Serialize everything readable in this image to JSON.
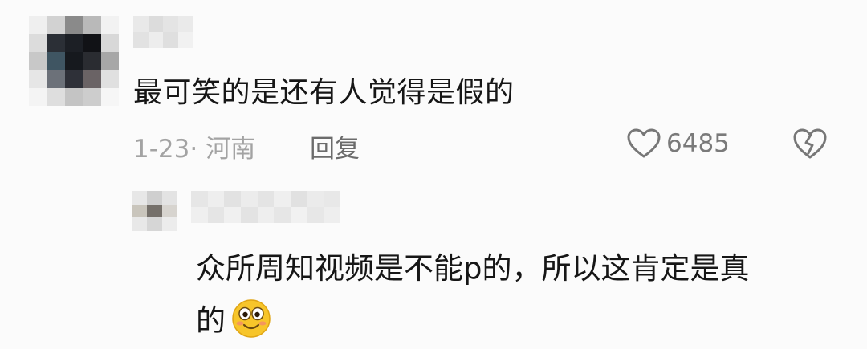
{
  "comment": {
    "text": "最可笑的是还有人觉得是假的",
    "date_location": "1-23· 河南",
    "reply_label": "回复",
    "like_count": "6485",
    "icons": {
      "like": "heart-outline-icon",
      "dislike": "broken-heart-icon"
    }
  },
  "reply": {
    "text_line1": "众所周知视频是不能p的，所以这肯定是真",
    "text_line2": "的",
    "emoji": "smiling-face-emoji"
  },
  "colors": {
    "background": "#fbfbfb",
    "text_primary": "#161616",
    "text_meta": "#a3a3a3",
    "icon": "#777777"
  }
}
